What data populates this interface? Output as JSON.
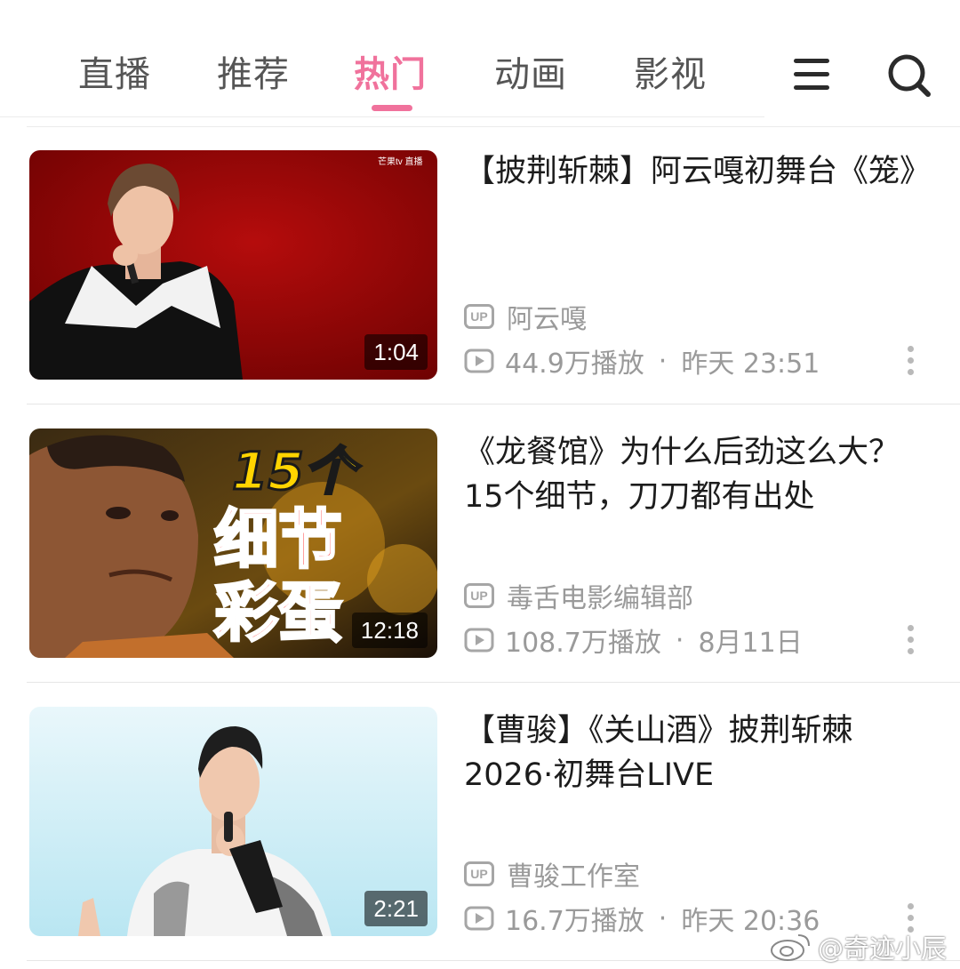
{
  "tabs": [
    {
      "label": "直播",
      "active": false
    },
    {
      "label": "推荐",
      "active": false
    },
    {
      "label": "热门",
      "active": true
    },
    {
      "label": "动画",
      "active": false
    },
    {
      "label": "影视",
      "active": false
    }
  ],
  "header_icons": {
    "menu": "hamburger-icon",
    "search": "search-icon"
  },
  "colors": {
    "accent": "#f0729c",
    "meta_text": "#9a9a9a"
  },
  "videos": [
    {
      "title": "【披荆斩棘】阿云嘎初舞台《笼》",
      "uploader": "阿云嘎",
      "views": "44.9万播放",
      "date": "昨天 23:51",
      "duration": "1:04",
      "thumb_logo": "芒果tv 直播"
    },
    {
      "title": "《龙餐馆》为什么后劲这么大？15个细节，刀刀都有出处",
      "uploader": "毒舌电影编辑部",
      "views": "108.7万播放",
      "date": "8月11日",
      "duration": "12:18",
      "thumb_text": [
        "15个",
        "细节",
        "彩蛋"
      ]
    },
    {
      "title": "【曹骏】《关山酒》披荆斩棘2026·初舞台LIVE",
      "uploader": "曹骏工作室",
      "views": "16.7万播放",
      "date": "昨天 20:36",
      "duration": "2:21"
    }
  ],
  "meta_separator": "·",
  "up_badge": "UP",
  "watermark": "@奇迹小辰"
}
